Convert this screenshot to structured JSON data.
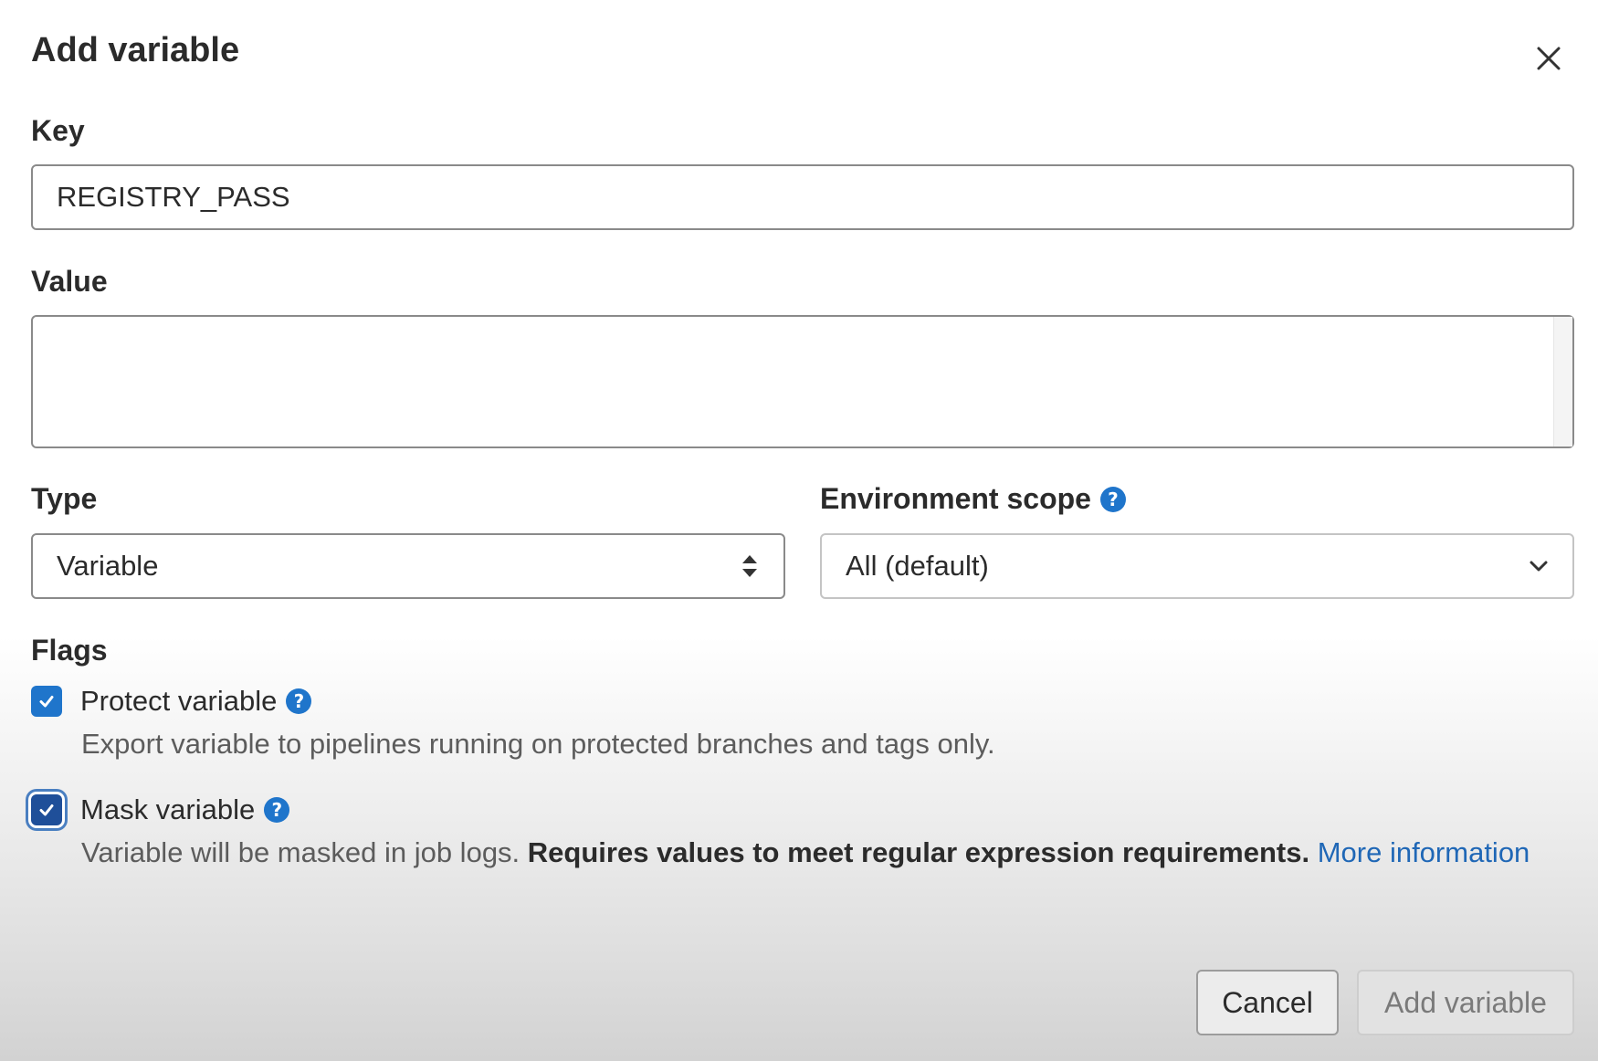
{
  "dialog": {
    "title": "Add variable",
    "close_icon": "close-icon"
  },
  "key": {
    "label": "Key",
    "value": "REGISTRY_PASS"
  },
  "value": {
    "label": "Value",
    "content": ""
  },
  "type": {
    "label": "Type",
    "selected": "Variable",
    "icon": "sort-arrows-icon"
  },
  "environment_scope": {
    "label": "Environment scope",
    "selected": "All (default)",
    "help_icon": "question-circle-icon",
    "icon": "chevron-down-icon"
  },
  "flags": {
    "label": "Flags",
    "protect": {
      "label": "Protect variable",
      "checked": true,
      "help": "Export variable to pipelines running on protected branches and tags only."
    },
    "mask": {
      "label": "Mask variable",
      "checked": true,
      "help_plain": "Variable will be masked in job logs.",
      "help_bold": "Requires values to meet regular expression requirements.",
      "help_link": "More information"
    }
  },
  "footer": {
    "cancel_label": "Cancel",
    "submit_label": "Add variable"
  },
  "colors": {
    "accent": "#1f75cb",
    "link": "#1f67b6"
  }
}
